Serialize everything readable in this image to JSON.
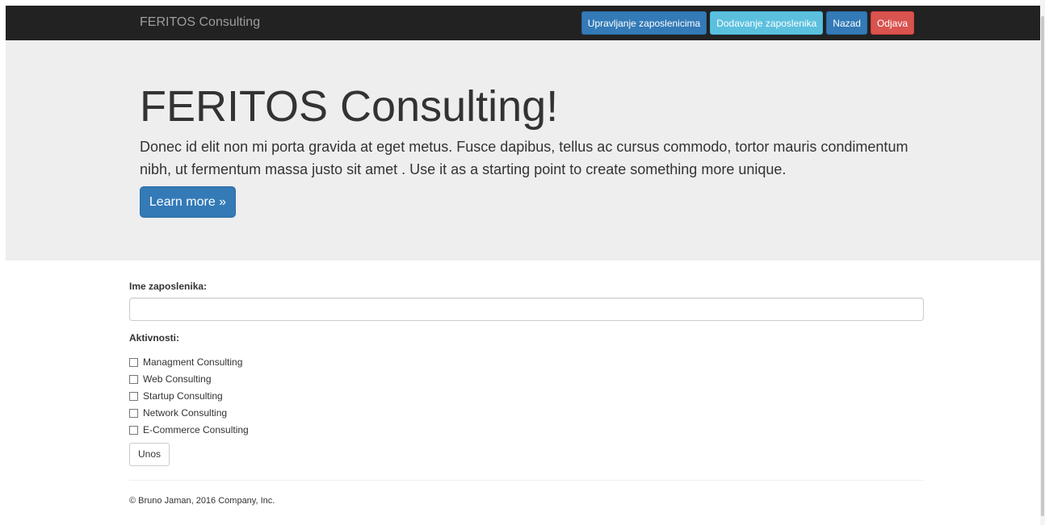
{
  "navbar": {
    "brand": "FERITOS Consulting",
    "buttons": [
      {
        "label": "Upravljanje zaposlenicima",
        "style": "primary"
      },
      {
        "label": "Dodavanje zaposlenika",
        "style": "info"
      },
      {
        "label": "Nazad",
        "style": "primary"
      },
      {
        "label": "Odjava",
        "style": "danger"
      }
    ]
  },
  "jumbotron": {
    "title": "FERITOS Consulting!",
    "text": "Donec id elit non mi porta gravida at eget metus. Fusce dapibus, tellus ac cursus commodo, tortor mauris condimentum nibh, ut fermentum massa justo sit amet . Use it as a starting point to create something more unique.",
    "button_label": "Learn more »"
  },
  "form": {
    "name_label": "Ime zaposlenika:",
    "name_value": "",
    "activities_label": "Aktivnosti:",
    "activities": [
      {
        "label": "Managment Consulting",
        "checked": false
      },
      {
        "label": "Web Consulting",
        "checked": false
      },
      {
        "label": "Startup Consulting",
        "checked": false
      },
      {
        "label": "Network Consulting",
        "checked": false
      },
      {
        "label": "E-Commerce Consulting",
        "checked": false
      }
    ],
    "submit_label": "Unos"
  },
  "footer": {
    "text": "© Bruno Jaman, 2016 Company, Inc."
  },
  "colors": {
    "navbar_bg": "#222222",
    "primary": "#337ab7",
    "info": "#5bc0de",
    "danger": "#d9534f",
    "jumbotron_bg": "#eeeeee"
  }
}
